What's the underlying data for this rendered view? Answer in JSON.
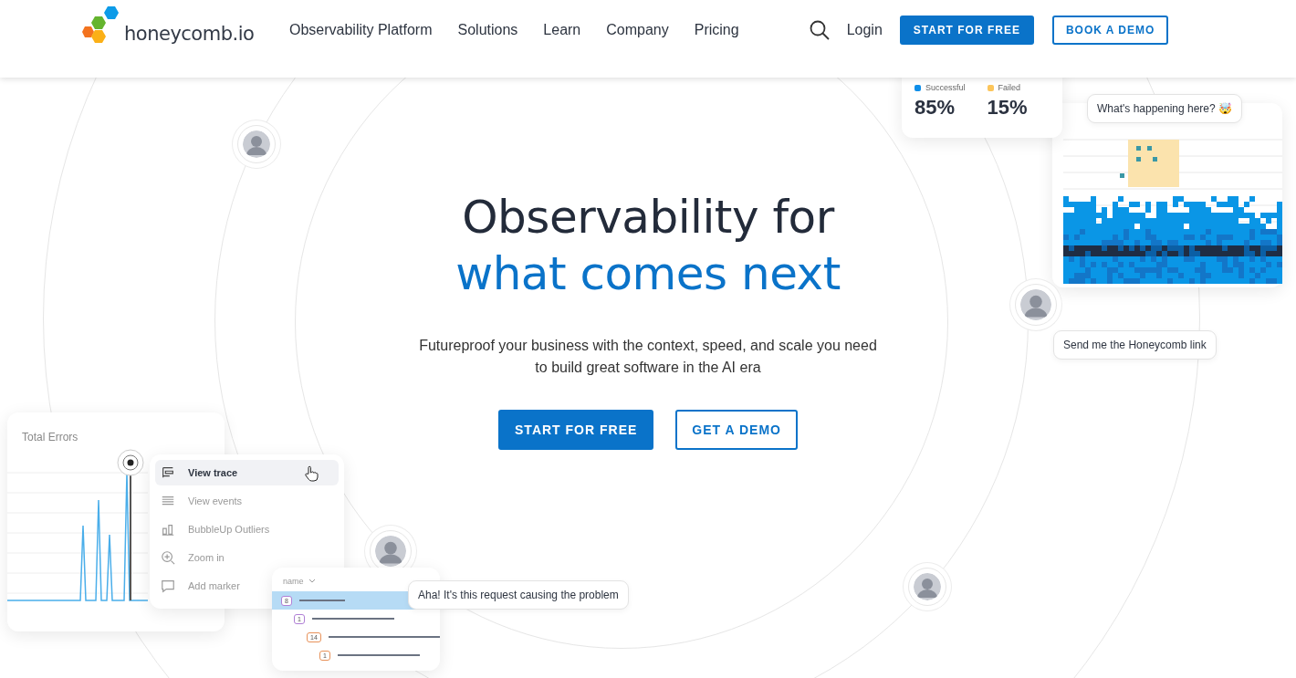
{
  "nav": {
    "logo": "honeycomb.io",
    "links": [
      "Observability Platform",
      "Solutions",
      "Learn",
      "Company",
      "Pricing"
    ],
    "login": "Login",
    "start_button": "START FOR FREE",
    "demo_button": "BOOK A DEMO"
  },
  "hero": {
    "title_line1": "Observability for",
    "title_line2": "what comes next",
    "subtitle": "Futureproof your business with the context, speed, and scale you need to build great software in the AI era",
    "primary_button": "START FOR FREE",
    "secondary_button": "GET A DEMO"
  },
  "stats_card": {
    "items": [
      {
        "label": "Successful",
        "color": "#0d8ee9",
        "value": "85%"
      },
      {
        "label": "Failed",
        "color": "#fcc55a",
        "value": "15%"
      }
    ]
  },
  "bubbles": {
    "top": "What's happening here? 🤯",
    "middle": "Send me the Honeycomb link",
    "bottom": "Aha! It's this request causing the problem"
  },
  "errors_card": {
    "title": "Total Errors"
  },
  "menu": {
    "items": [
      {
        "kind": "trace",
        "label": "View trace",
        "selected": true
      },
      {
        "kind": "events",
        "label": "View events",
        "selected": false
      },
      {
        "kind": "bubbleup",
        "label": "BubbleUp Outliers",
        "selected": false
      },
      {
        "kind": "zoom",
        "label": "Zoom in",
        "selected": false
      },
      {
        "kind": "marker",
        "label": "Add marker",
        "selected": false
      }
    ]
  },
  "trace_card": {
    "header": "name",
    "spans": [
      {
        "count": "8",
        "color": "#b07fd6",
        "selected": true
      },
      {
        "count": "1",
        "color": "#b07fd6",
        "selected": false
      },
      {
        "count": "14",
        "color": "#e8925a",
        "selected": false
      },
      {
        "count": "1",
        "color": "#e8925a",
        "selected": false
      }
    ]
  }
}
